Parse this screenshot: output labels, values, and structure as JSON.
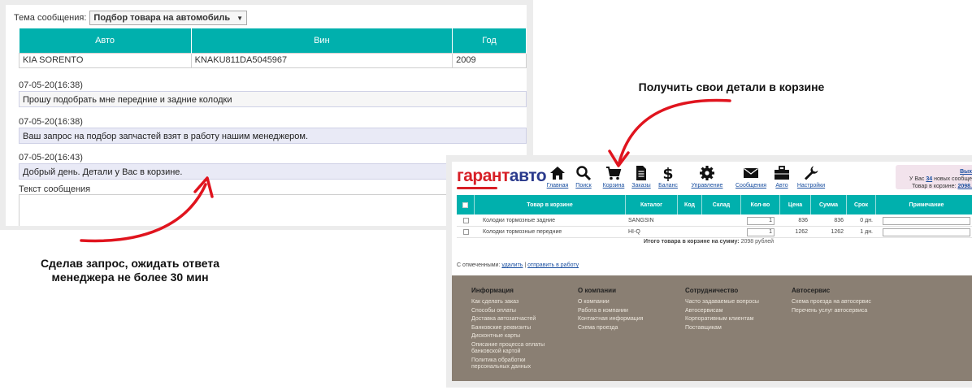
{
  "thread": {
    "subject_label": "Тема сообщения:",
    "subject_value": "Подбор товара на автомобиль",
    "car_table": {
      "headers": [
        "Авто",
        "Вин",
        "Год"
      ],
      "row": [
        "KIA SORENTO",
        "KNAKU811DA5045967",
        "2009"
      ]
    },
    "messages": [
      {
        "date": "07-05-20(16:38)",
        "text": "Прошу подобрать мне передние и задние колодки",
        "author": "client"
      },
      {
        "date": "07-05-20(16:38)",
        "text": "Ваш запрос на подбор запчастей взят в работу нашим менеджером.",
        "author": "manager"
      },
      {
        "date": "07-05-20(16:43)",
        "text": "Добрый день. Детали у Вас в корзине.",
        "author": "manager"
      }
    ],
    "reply_label": "Текст сообщения"
  },
  "captions": {
    "left_line1": "Сделав запрос, ожидать ответа",
    "left_line2": "менеджера не более 30 мин",
    "right": "Получить свои детали в корзине"
  },
  "cart_site": {
    "logo_part1": "гарант",
    "logo_part2": "авто",
    "nav": [
      {
        "label": "Главная",
        "icon": "home-icon"
      },
      {
        "label": "Поиск",
        "icon": "search-icon"
      },
      {
        "label": "Корзина",
        "icon": "cart-icon"
      },
      {
        "label": "Заказы",
        "icon": "document-icon"
      },
      {
        "label": "Баланс",
        "icon": "dollar-icon"
      },
      {
        "label": "Управление",
        "icon": "gear-icon"
      },
      {
        "label": "Сообщения",
        "icon": "envelope-icon"
      },
      {
        "label": "Авто",
        "icon": "briefcase-icon"
      },
      {
        "label": "Настройки",
        "icon": "wrench-icon"
      }
    ],
    "info": {
      "exit": "Вых",
      "new_prefix": "У Вас",
      "new_count": "34",
      "new_suffix": "новых сообще",
      "cart_prefix": "Товар в корзине:",
      "cart_sum": "2098."
    },
    "table": {
      "headers": [
        "Товар в корзине",
        "Каталог",
        "Код",
        "Склад",
        "Кол-во",
        "Цена",
        "Сумма",
        "Срок",
        "Примечание"
      ],
      "rows": [
        {
          "name": "Колодки тормозные задние",
          "catalog": "SANGSIN",
          "code": "",
          "stock": "",
          "qty": "1",
          "price": "836",
          "sum": "836",
          "term": "0 дн."
        },
        {
          "name": "Колодки тормозные передние",
          "catalog": "HI-Q",
          "code": "",
          "stock": "",
          "qty": "1",
          "price": "1262",
          "sum": "1262",
          "term": "1 дн."
        }
      ],
      "total_label": "Итого товара в корзине на сумму:",
      "total_value": "2098 рублей"
    },
    "actions": {
      "label": "С отмеченными:",
      "delete": "удалить",
      "separator": "|",
      "send": "отправить в работу"
    },
    "footer": [
      {
        "title": "Информация",
        "links": [
          "Как сделать заказ",
          "Способы оплаты",
          "Доставка автозапчастей",
          "Банковские реквизиты",
          "Дисконтные карты",
          "Описание процесса оплаты банковской картой",
          "Политика обработки персональных данных"
        ]
      },
      {
        "title": "О компании",
        "links": [
          "О компании",
          "Работа в компании",
          "Контактная информация",
          "Схема проезда"
        ]
      },
      {
        "title": "Сотрудничество",
        "links": [
          "Часто задаваемые вопросы",
          "Автосервисам",
          "Корпоративным клиентам",
          "Поставщикам"
        ]
      },
      {
        "title": "Автосервис",
        "links": [
          "Схема проезда на автосервис",
          "Перечень услуг автосервиса"
        ]
      }
    ]
  },
  "colors": {
    "teal": "#00b0ad",
    "arrow": "#e0141e",
    "footer": "#8a7f73",
    "logo_red": "#d71f26",
    "logo_blue": "#2a3a8c"
  }
}
